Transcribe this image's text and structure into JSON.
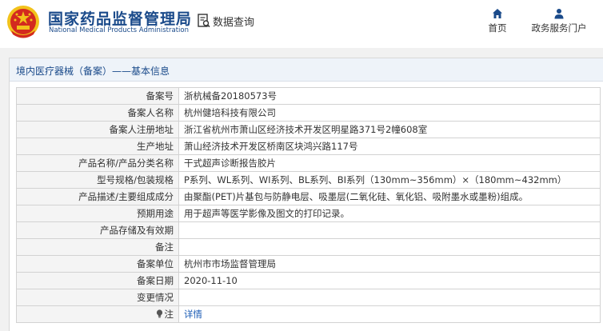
{
  "header": {
    "brand_cn": "国家药品监督管理局",
    "brand_en": "National Medical Products Administration",
    "emblem_icon": "national-emblem-icon",
    "query_label": "数据查询",
    "query_icon": "document-search-icon",
    "nav": [
      {
        "label": "首页",
        "icon": "home-icon"
      },
      {
        "label": "政务服务门户",
        "icon": "user-icon"
      }
    ]
  },
  "panel": {
    "title": "境内医疗器械（备案）——基本信息"
  },
  "table": {
    "rows": [
      {
        "label": "备案号",
        "value": "浙杭械备20180573号"
      },
      {
        "label": "备案人名称",
        "value": "杭州健培科技有限公司"
      },
      {
        "label": "备案人注册地址",
        "value": "浙江省杭州市萧山区经济技术开发区明星路371号2幢608室"
      },
      {
        "label": "生产地址",
        "value": "萧山经济技术开发区桥南区块鸿兴路117号"
      },
      {
        "label": "产品名称/产品分类名称",
        "value": "干式超声诊断报告胶片"
      },
      {
        "label": "型号规格/包装规格",
        "value": "P系列、WL系列、WI系列、BL系列、BI系列（130mm~356mm）×（180mm~432mm）"
      },
      {
        "label": "产品描述/主要组成成分",
        "value": "由聚酯(PET)片基包与防静电层、吸墨层(二氧化硅、氧化铝、吸附墨水或墨粉)组成。"
      },
      {
        "label": "预期用途",
        "value": "用于超声等医学影像及图文的打印记录。"
      },
      {
        "label": "产品存储及有效期",
        "value": ""
      },
      {
        "label": "备注",
        "value": ""
      },
      {
        "label": "备案单位",
        "value": "杭州市市场监督管理局"
      },
      {
        "label": "备案日期",
        "value": "2020-11-10"
      },
      {
        "label": "变更情况",
        "value": ""
      },
      {
        "label": "注",
        "value": "详情",
        "icon": "bulb-icon"
      }
    ]
  },
  "colors": {
    "brand": "#1a4a8a",
    "link": "#1c5db5",
    "label_bg": "#f4f4f4",
    "emblem_red": "#d32a1f",
    "emblem_gold": "#f2c21b"
  }
}
